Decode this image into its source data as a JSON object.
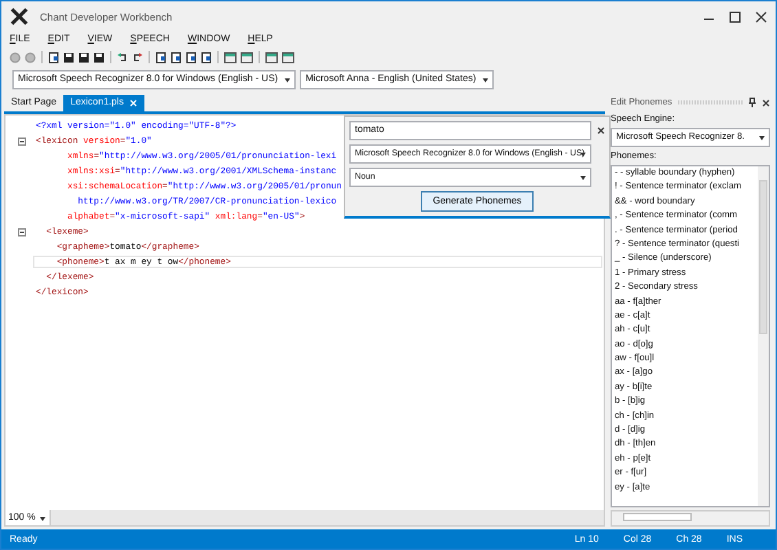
{
  "window": {
    "title": "Chant Developer Workbench"
  },
  "menu": [
    "FILE",
    "EDIT",
    "VIEW",
    "SPEECH",
    "WINDOW",
    "HELP"
  ],
  "engine_bar": {
    "recognizer": "Microsoft Speech Recognizer 8.0 for Windows (English - US)",
    "voice": "Microsoft Anna - English (United States)"
  },
  "tabs": [
    {
      "label": "Start Page",
      "selected": false
    },
    {
      "label": "Lexicon1.pls",
      "selected": true
    }
  ],
  "editor": {
    "lines": [
      {
        "fold": false,
        "current": false,
        "segs": [
          {
            "kind": "pi",
            "text": "<?xml version=\"1.0\" encoding=\"UTF-8\"?>"
          }
        ]
      },
      {
        "fold": true,
        "current": false,
        "segs": [
          {
            "kind": "tag",
            "text": "<lexicon "
          },
          {
            "kind": "attr",
            "text": "version"
          },
          {
            "kind": "tag",
            "text": "="
          },
          {
            "kind": "val",
            "text": "\"1.0\""
          }
        ]
      },
      {
        "fold": false,
        "current": false,
        "segs": [
          {
            "kind": "attr",
            "text": "      xmlns"
          },
          {
            "kind": "tag",
            "text": "="
          },
          {
            "kind": "val",
            "text": "\"http://www.w3.org/2005/01/pronunciation-lexi"
          }
        ]
      },
      {
        "fold": false,
        "current": false,
        "segs": [
          {
            "kind": "attr",
            "text": "      xmlns:xsi"
          },
          {
            "kind": "tag",
            "text": "="
          },
          {
            "kind": "val",
            "text": "\"http://www.w3.org/2001/XMLSchema-instanc"
          }
        ]
      },
      {
        "fold": false,
        "current": false,
        "segs": [
          {
            "kind": "attr",
            "text": "      xsi:schemaLocation"
          },
          {
            "kind": "tag",
            "text": "="
          },
          {
            "kind": "val",
            "text": "\"http://www.w3.org/2005/01/pronun"
          }
        ]
      },
      {
        "fold": false,
        "current": false,
        "segs": [
          {
            "kind": "val",
            "text": "        http://www.w3.org/TR/2007/CR-pronunciation-lexico"
          }
        ]
      },
      {
        "fold": false,
        "current": false,
        "segs": [
          {
            "kind": "attr",
            "text": "      alphabet"
          },
          {
            "kind": "tag",
            "text": "="
          },
          {
            "kind": "val",
            "text": "\"x-microsoft-sapi\" "
          },
          {
            "kind": "attr",
            "text": "xml:lang"
          },
          {
            "kind": "tag",
            "text": "="
          },
          {
            "kind": "val",
            "text": "\"en-US\""
          },
          {
            "kind": "tag",
            "text": ">"
          }
        ]
      },
      {
        "fold": true,
        "current": false,
        "segs": [
          {
            "kind": "tag",
            "text": "  <lexeme>"
          }
        ]
      },
      {
        "fold": false,
        "current": false,
        "segs": [
          {
            "kind": "tag",
            "text": "    <grapheme>"
          },
          {
            "kind": "text",
            "text": "tomato"
          },
          {
            "kind": "tag",
            "text": "</grapheme>"
          }
        ]
      },
      {
        "fold": false,
        "current": true,
        "segs": [
          {
            "kind": "tag",
            "text": "    <phoneme>"
          },
          {
            "kind": "text",
            "text": "t ax m ey t ow"
          },
          {
            "kind": "tag",
            "text": "</phoneme>"
          }
        ]
      },
      {
        "fold": false,
        "current": false,
        "segs": [
          {
            "kind": "tag",
            "text": "  </lexeme>"
          }
        ]
      },
      {
        "fold": false,
        "current": false,
        "segs": [
          {
            "kind": "tag",
            "text": "</lexicon>"
          }
        ]
      }
    ],
    "zoom": "100 %"
  },
  "popup": {
    "word": "tomato",
    "engine": "Microsoft Speech Recognizer 8.0 for Windows (English - US)",
    "part_of_speech": "Noun",
    "button": "Generate Phonemes"
  },
  "panel": {
    "title": "Edit Phonemes",
    "engine_label": "Speech Engine:",
    "engine": "Microsoft Speech Recognizer 8.",
    "phonemes_label": "Phonemes:",
    "phonemes": [
      "- - syllable boundary (hyphen)",
      "! - Sentence terminator (exclam",
      "&& - word boundary",
      ", - Sentence terminator (comm",
      ". - Sentence terminator (period",
      "? - Sentence terminator (questi",
      "_ - Silence (underscore)",
      "1 - Primary stress",
      "2 - Secondary stress",
      "aa - f[a]ther",
      "ae - c[a]t",
      "ah - c[u]t",
      "ao - d[o]g",
      "aw - f[ou]l",
      "ax - [a]go",
      "ay - b[i]te",
      "b - [b]ig",
      "ch - [ch]in",
      "d - [d]ig",
      "dh - [th]en",
      "eh - p[e]t",
      "er - f[ur]",
      "ey - [a]te"
    ]
  },
  "status_bar": {
    "message": "Ready",
    "line": "Ln 10",
    "column": "Col 28",
    "char": "Ch 28",
    "mode": "INS"
  }
}
